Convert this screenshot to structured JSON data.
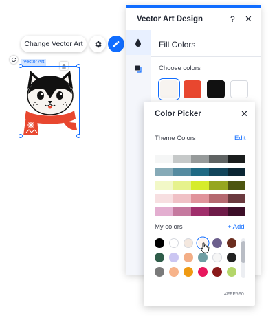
{
  "toolbar": {
    "change_label": "Change Vector Art",
    "gear_icon": "gear-icon",
    "pen_icon": "pen-icon",
    "accent": "#116dff"
  },
  "selection": {
    "tag": "Vector Art"
  },
  "design_panel": {
    "title": "Vector Art Design",
    "help": "?",
    "close": "✕",
    "section_title": "Fill Colors",
    "choose_label": "Choose colors",
    "swatches": [
      "#f7f4f0",
      "#e8472f",
      "#111111",
      "#ffffff"
    ]
  },
  "picker": {
    "title": "Color Picker",
    "close": "✕",
    "theme_label": "Theme Colors",
    "edit_label": "Edit",
    "theme_rows": [
      [
        "#f5f6f6",
        "#c6c9c9",
        "#969a9a",
        "#5f6363",
        "#1a1d1d"
      ],
      [
        "#86aab7",
        "#558ba0",
        "#1f6a84",
        "#12455b",
        "#0b2633"
      ],
      [
        "#f2f8c7",
        "#e6f28c",
        "#d6ec2c",
        "#96a61f",
        "#4d5510"
      ],
      [
        "#f7dfe1",
        "#f0c1c6",
        "#e0939b",
        "#b56970",
        "#6b3a3f"
      ],
      [
        "#e3aed0",
        "#c5799f",
        "#a02e6b",
        "#6e1b48",
        "#3c0e28"
      ]
    ],
    "mycolors_label": "My colors",
    "add_label": "+ Add",
    "my_colors": [
      [
        "#000000",
        "#ffffff",
        "#f4e8df",
        "#fff5f0",
        "#6c5f8d",
        "#6b2d1f"
      ],
      [
        "#2f5d4a",
        "#cbc6f2",
        "#f3ae86",
        "#6f9ea3",
        "#f6f6f6",
        "#222222"
      ],
      [
        "#7a7a7a",
        "#f7b38a",
        "#ef9a12",
        "#e8175d",
        "#8a1a1a",
        "#b4d66a"
      ]
    ],
    "selected_hex": "#FFF5F0"
  }
}
